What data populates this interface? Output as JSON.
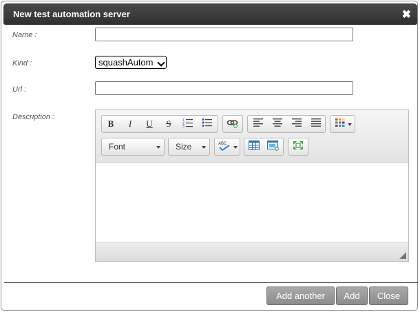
{
  "dialog": {
    "title": "New test automation server",
    "close_glyph": "✖"
  },
  "form": {
    "name_label": "Name :",
    "name_value": "",
    "kind_label": "Kind :",
    "kind_selected": "squashAutom",
    "url_label": "Url :",
    "url_value": "",
    "description_label": "Description :"
  },
  "editor": {
    "bold": "B",
    "italic": "I",
    "underline": "U",
    "strike": "S",
    "font_combo": "Font",
    "size_combo": "Size",
    "spell_text": "ABC",
    "content": ""
  },
  "footer": {
    "add_another": "Add another",
    "add": "Add",
    "close": "Close"
  },
  "colors": {
    "titlebar": "#3a3a3a",
    "button": "#999999"
  }
}
